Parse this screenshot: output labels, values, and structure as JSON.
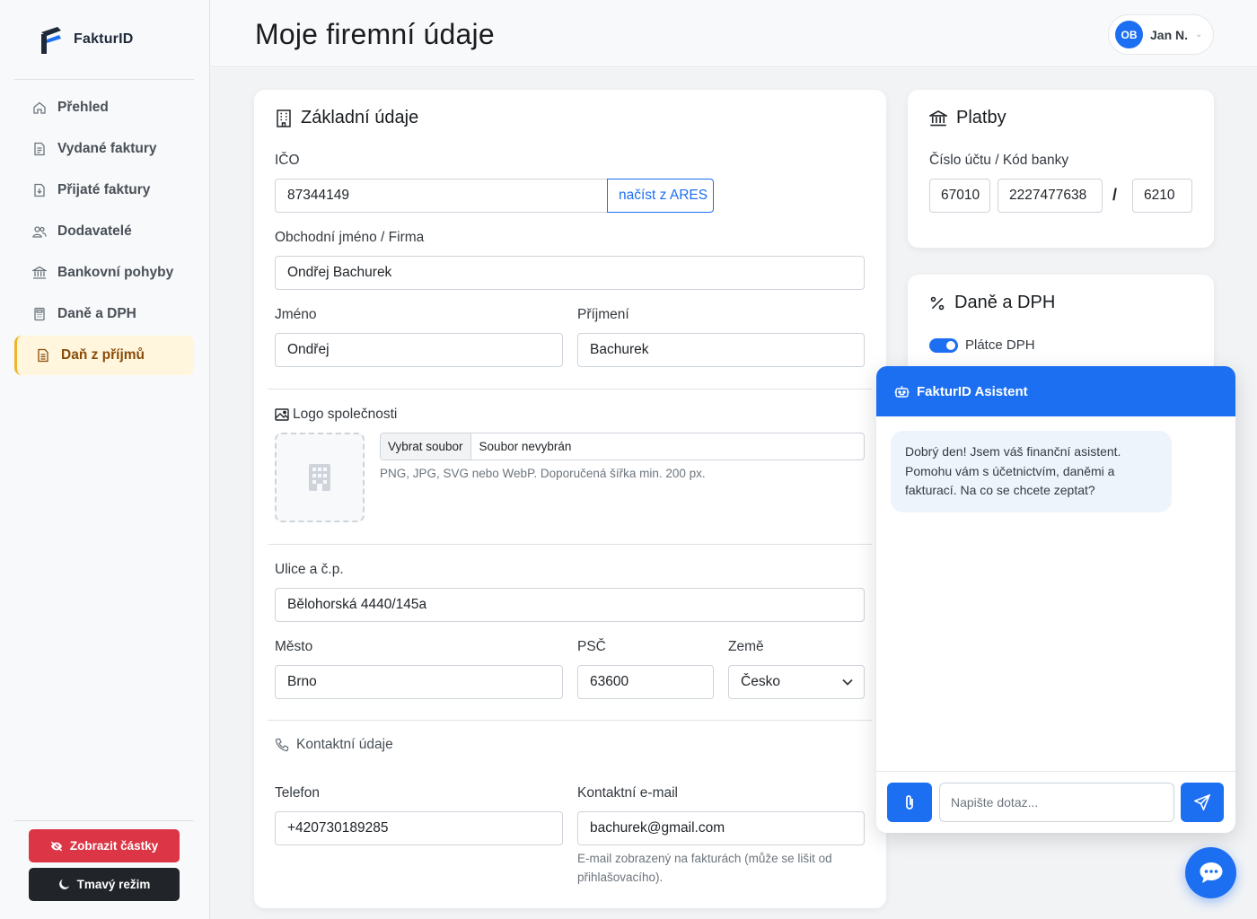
{
  "app": {
    "name": "FakturID"
  },
  "sidebar": {
    "items": [
      {
        "label": "Přehled",
        "icon": "home-icon"
      },
      {
        "label": "Vydané faktury",
        "icon": "document-icon"
      },
      {
        "label": "Přijaté faktury",
        "icon": "document-download-icon"
      },
      {
        "label": "Dodavatelé",
        "icon": "users-icon"
      },
      {
        "label": "Bankovní pohyby",
        "icon": "bank-icon"
      },
      {
        "label": "Daně a DPH",
        "icon": "calculator-icon"
      },
      {
        "label": "Daň z příjmů",
        "icon": "receipt-icon",
        "active": true
      }
    ],
    "show_amounts": "Zobrazit částky",
    "dark_mode": "Tmavý režim"
  },
  "header": {
    "title": "Moje firemní údaje",
    "user_initials": "OB",
    "user_name": "Jan N."
  },
  "basic": {
    "title": "Základní údaje",
    "ico_label": "IČO",
    "ico_value": "87344149",
    "ares_button": "načíst z ARES",
    "company_label": "Obchodní jméno / Firma",
    "company_value": "Ondřej Bachurek",
    "first_name_label": "Jméno",
    "first_name_value": "Ondřej",
    "last_name_label": "Příjmení",
    "last_name_value": "Bachurek",
    "logo_label": "Logo společnosti",
    "file_button": "Vybrat soubor",
    "file_none": "Soubor nevybrán",
    "file_hint": "PNG, JPG, SVG nebo WebP. Doporučená šířka min. 200 px.",
    "street_label": "Ulice a č.p.",
    "street_value": "Bělohorská 4440/145a",
    "city_label": "Město",
    "city_value": "Brno",
    "zip_label": "PSČ",
    "zip_value": "63600",
    "country_label": "Země",
    "country_value": "Česko",
    "contact_section": "Kontaktní údaje",
    "phone_label": "Telefon",
    "phone_value": "+420730189285",
    "email_label": "Kontaktní e-mail",
    "email_value": "bachurek@gmail.com",
    "email_hint": "E-mail zobrazený na fakturách (může se lišit od přihlašovacího)."
  },
  "payments": {
    "title": "Platby",
    "account_label": "Číslo účtu / Kód banky",
    "prefix": "67010",
    "account": "2227477638",
    "slash": "/",
    "bank_code": "6210"
  },
  "taxes": {
    "title": "Daně a DPH",
    "vat_payer_label": "Plátce DPH",
    "vat_payer": true
  },
  "chat": {
    "title": "FakturID Asistent",
    "welcome": "Dobrý den! Jsem váš finanční asistent. Pomohu vám s účetnictvím, daněmi a fakturací. Na co se chcete zeptat?",
    "placeholder": "Napište dotaz..."
  },
  "colors": {
    "primary": "#1d6ff2",
    "danger": "#dc3545",
    "dark": "#212529",
    "active_bg": "#fff6dd",
    "active_text": "#8a4b08"
  }
}
